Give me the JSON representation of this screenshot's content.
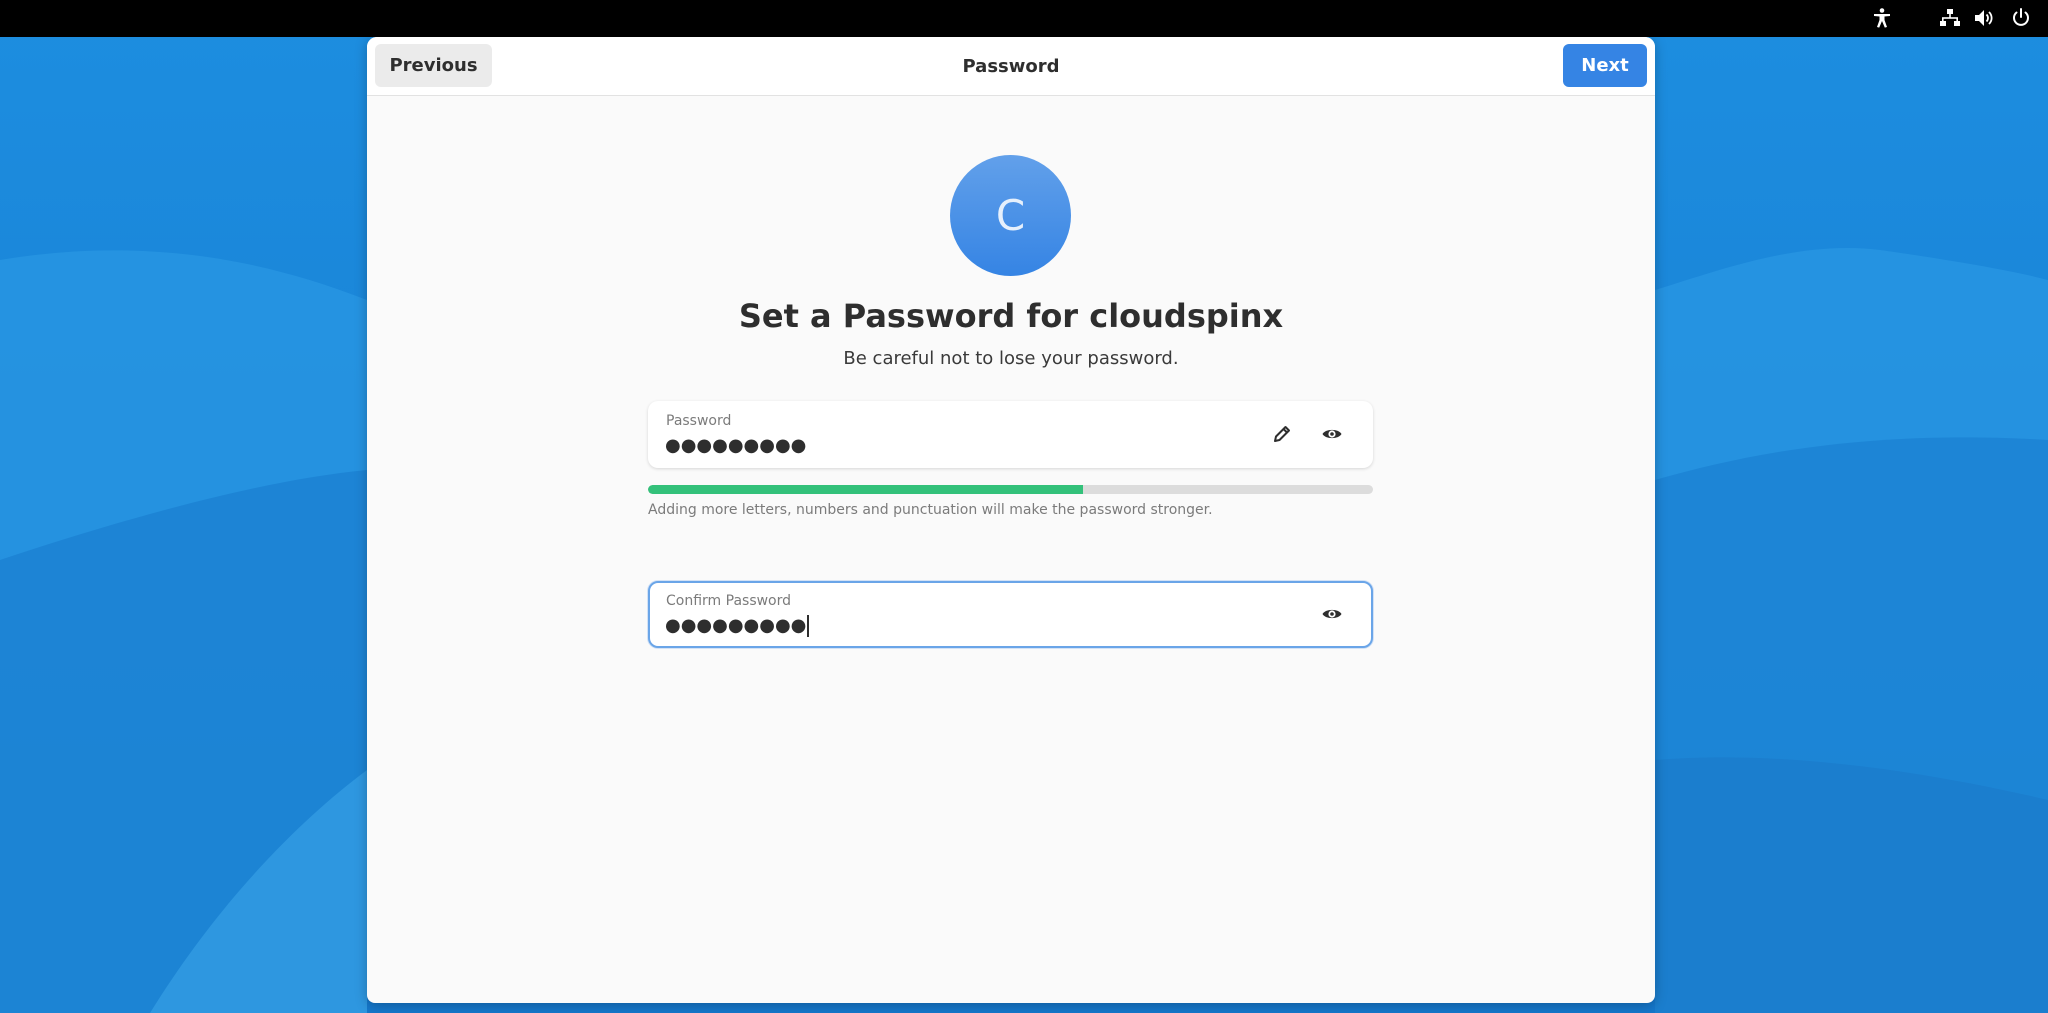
{
  "topbar": {
    "icons": [
      "accessibility-icon",
      "network-icon",
      "volume-icon",
      "power-icon"
    ]
  },
  "header": {
    "previous_label": "Previous",
    "title": "Password",
    "next_label": "Next"
  },
  "avatar": {
    "initial": "C"
  },
  "main": {
    "title": "Set a Password for cloudspinx",
    "subtitle": "Be careful not to lose your password."
  },
  "password_field": {
    "label": "Password",
    "value": "●●●●●●●●●"
  },
  "strength": {
    "fraction": 0.6,
    "hint": "Adding more letters, numbers and punctuation will make the password stronger."
  },
  "confirm_field": {
    "label": "Confirm Password",
    "value": "●●●●●●●●●"
  },
  "colors": {
    "accent": "#3584e4",
    "strength": "#33c17a",
    "wallpaper": "#1b86d8"
  }
}
